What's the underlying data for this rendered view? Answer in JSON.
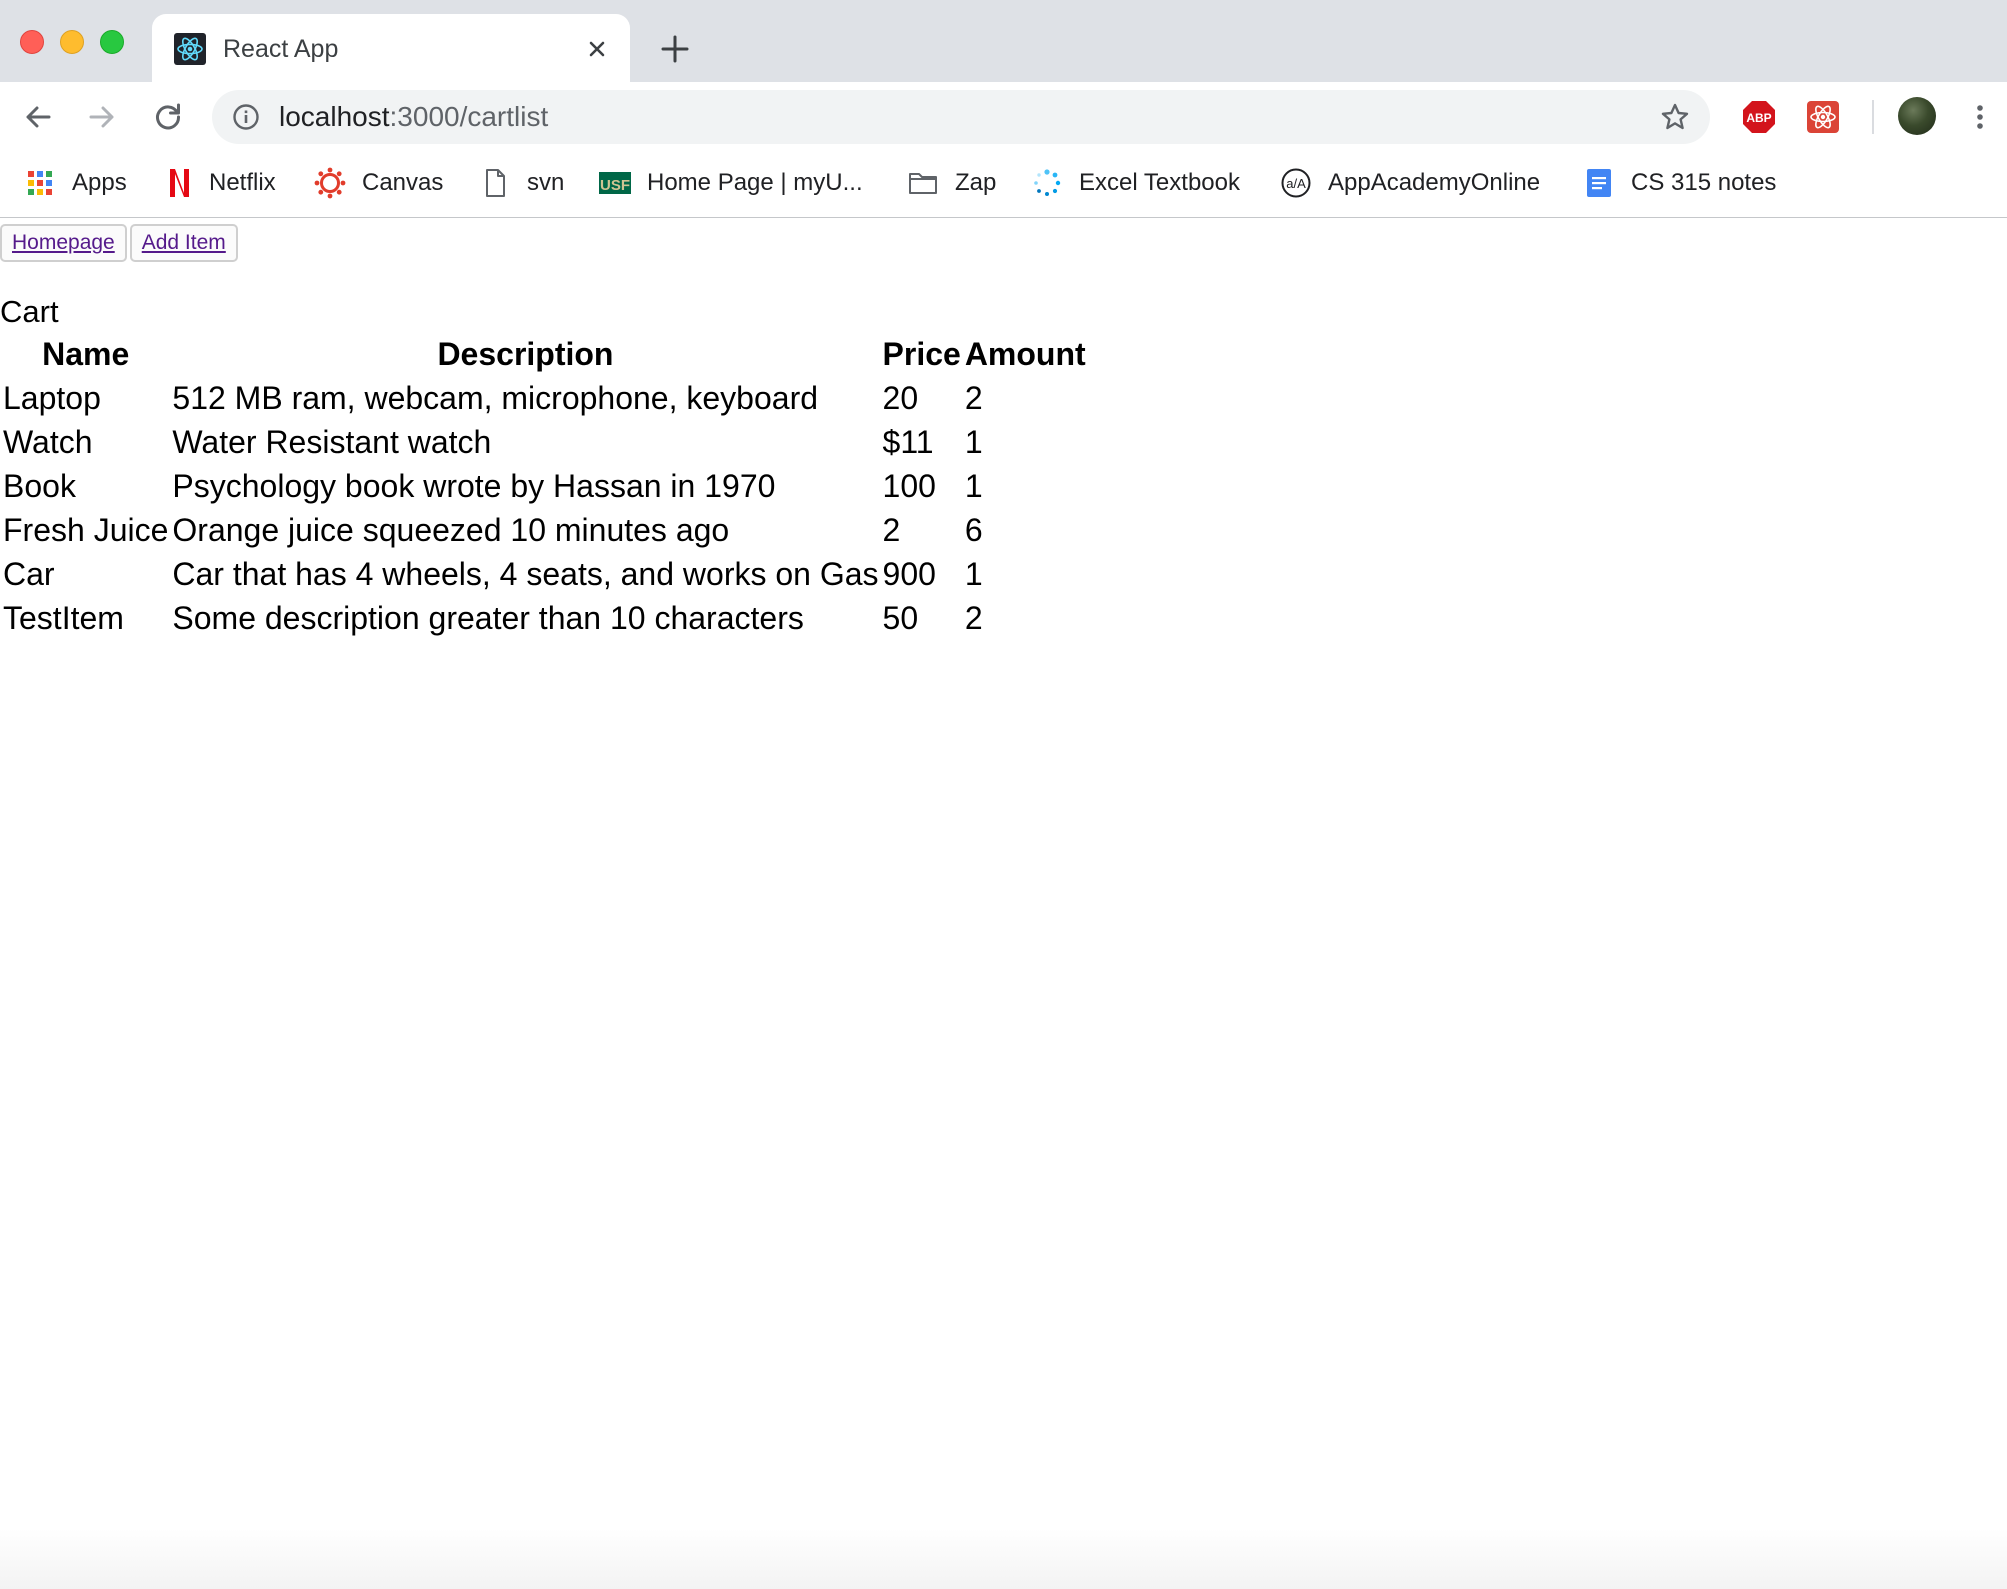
{
  "tab": {
    "title": "React App"
  },
  "address": {
    "host": "localhost",
    "rest": ":3000/cartlist"
  },
  "bookmarks": [
    {
      "label": "Apps",
      "icon": "apps-grid-icon"
    },
    {
      "label": "Netflix",
      "icon": "netflix-icon"
    },
    {
      "label": "Canvas",
      "icon": "canvas-icon"
    },
    {
      "label": "svn",
      "icon": "document-icon"
    },
    {
      "label": "Home Page | myU...",
      "icon": "usf-icon"
    },
    {
      "label": "Zap",
      "icon": "folder-icon"
    },
    {
      "label": "Excel Textbook",
      "icon": "spinner-icon"
    },
    {
      "label": "AppAcademyOnline",
      "icon": "appacademy-icon"
    },
    {
      "label": "CS 315 notes",
      "icon": "google-docs-icon"
    }
  ],
  "extensions": {
    "abp_label": "ABP"
  },
  "page": {
    "nav": {
      "homepage_label": "Homepage",
      "add_item_label": "Add Item"
    },
    "cart_title": "Cart",
    "table": {
      "headers": [
        "Name",
        "Description",
        "Price",
        "Amount"
      ],
      "rows": [
        [
          "Laptop",
          "512 MB ram, webcam, microphone, keyboard",
          "20",
          "2"
        ],
        [
          "Watch",
          "Water Resistant watch",
          "$11",
          "1"
        ],
        [
          "Book",
          "Psychology book wrote by Hassan in 1970",
          "100",
          "1"
        ],
        [
          "Fresh Juice",
          "Orange juice squeezed 10 minutes ago",
          "2",
          "6"
        ],
        [
          "Car",
          "Car that has 4 wheels, 4 seats, and works on Gas",
          "900",
          "1"
        ],
        [
          "TestItem",
          "Some description greater than 10 characters",
          "50",
          "2"
        ]
      ]
    }
  },
  "colors": {
    "tabstrip": "#dee1e6",
    "link_visited": "#551a8b",
    "close_red": "#ff5f57",
    "minimize_yellow": "#febc2e",
    "zoom_green": "#28c840"
  }
}
